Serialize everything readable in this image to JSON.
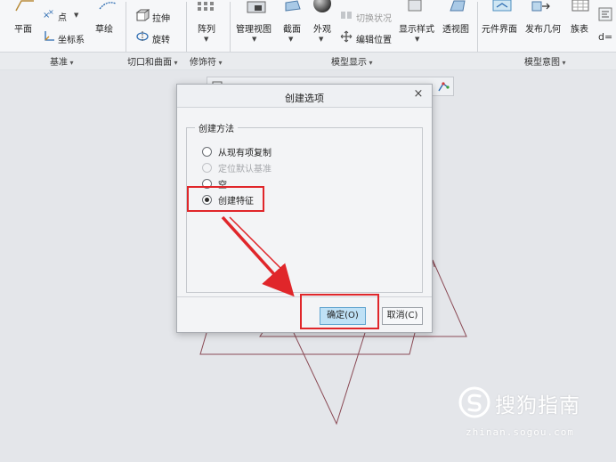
{
  "ribbon": {
    "buttons": {
      "plane": "平面",
      "point": "点",
      "coord_sys": "坐标系",
      "sketch": "草绘",
      "extrude": "拉伸",
      "revolve": "旋转",
      "pattern": "阵列",
      "manage_views": "管理视图",
      "section": "截面",
      "appearance": "外观",
      "toggle_status": "切换状况",
      "edit_position": "编辑位置",
      "display_style": "显示样式",
      "perspective": "透视图",
      "component_interface": "元件界面",
      "publish_geometry": "发布几何",
      "family_table": "族表"
    },
    "groups": {
      "datum": "基准",
      "cut_surface": "切口和曲面",
      "modifiers": "修饰符",
      "model_display": "模型显示",
      "model_intent": "模型意图"
    }
  },
  "dialog": {
    "title": "创建选项",
    "close": "×",
    "group_label": "创建方法",
    "options": [
      {
        "label": "从现有项复制",
        "checked": false,
        "enabled": true
      },
      {
        "label": "定位默认基准",
        "checked": false,
        "enabled": false
      },
      {
        "label": "空",
        "checked": false,
        "enabled": true
      },
      {
        "label": "创建特征",
        "checked": true,
        "enabled": true
      }
    ],
    "ok_label": "确定(O)",
    "cancel_label": "取消(C)"
  },
  "watermark": {
    "brand": "搜狗指南",
    "url": "zhinan.sogou.com"
  },
  "colors": {
    "highlight": "#e0262a",
    "primary_button": "#bfe1f6",
    "sketch_lines": "#8a4a55"
  }
}
